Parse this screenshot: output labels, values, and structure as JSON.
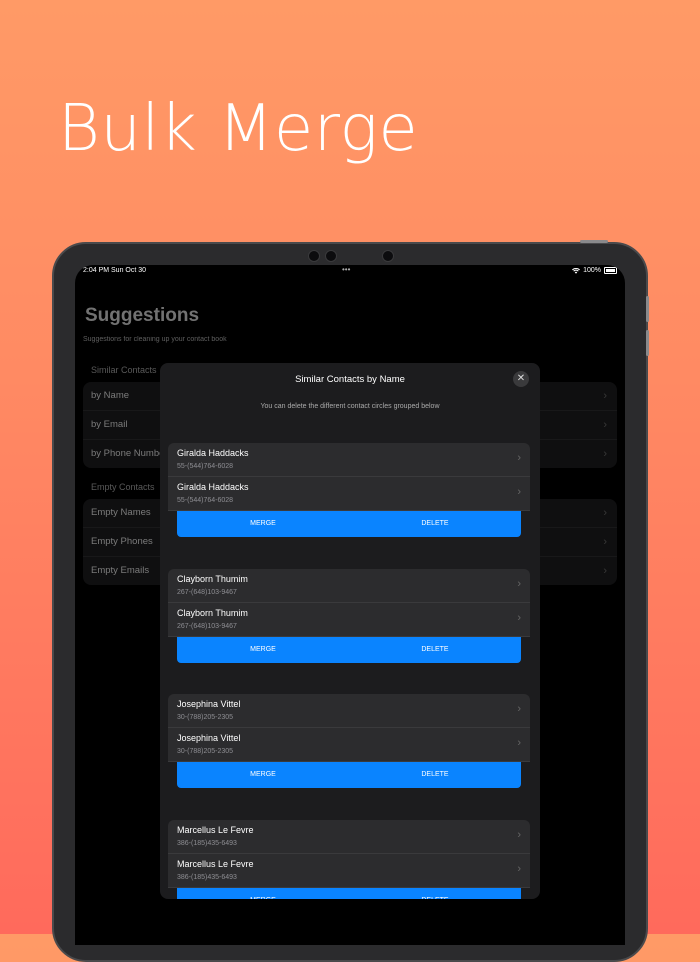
{
  "headline": "Bulk Merge",
  "status_bar": {
    "time": "2:04 PM  Sun Oct 30",
    "battery": "100%",
    "dots": "•••"
  },
  "background_screen": {
    "title": "Suggestions",
    "subtitle": "Suggestions for cleaning up your contact book",
    "sections": [
      {
        "label": "Similar Contacts",
        "items": [
          "by Name",
          "by Email",
          "by Phone Number"
        ]
      },
      {
        "label": "Empty Contacts",
        "items": [
          "Empty Names",
          "Empty Phones",
          "Empty Emails"
        ]
      }
    ]
  },
  "modal": {
    "title": "Similar Contacts by Name",
    "close_icon": "close-icon",
    "description": "You can delete the different contact circles grouped below",
    "merge_label": "MERGE",
    "delete_label": "DELETE",
    "groups": [
      {
        "contacts": [
          {
            "name": "Giralda Haddacks",
            "phone": "55-(544)764-6028"
          },
          {
            "name": "Giralda Haddacks",
            "phone": "55-(544)764-6028"
          }
        ]
      },
      {
        "contacts": [
          {
            "name": "Clayborn Thumim",
            "phone": "267-(648)103-9467"
          },
          {
            "name": "Clayborn Thumim",
            "phone": "267-(648)103-9467"
          }
        ]
      },
      {
        "contacts": [
          {
            "name": "Josephina Vittel",
            "phone": "30-(788)205-2305"
          },
          {
            "name": "Josephina Vittel",
            "phone": "30-(788)205-2305"
          }
        ]
      },
      {
        "contacts": [
          {
            "name": "Marcellus Le Fevre",
            "phone": "386-(185)435-6493"
          },
          {
            "name": "Marcellus Le Fevre",
            "phone": "386-(185)435-6493"
          }
        ]
      }
    ]
  },
  "colors": {
    "accent": "#0a84ff",
    "background_top": "#ff9a66",
    "background_bottom": "#ff6a5c"
  }
}
